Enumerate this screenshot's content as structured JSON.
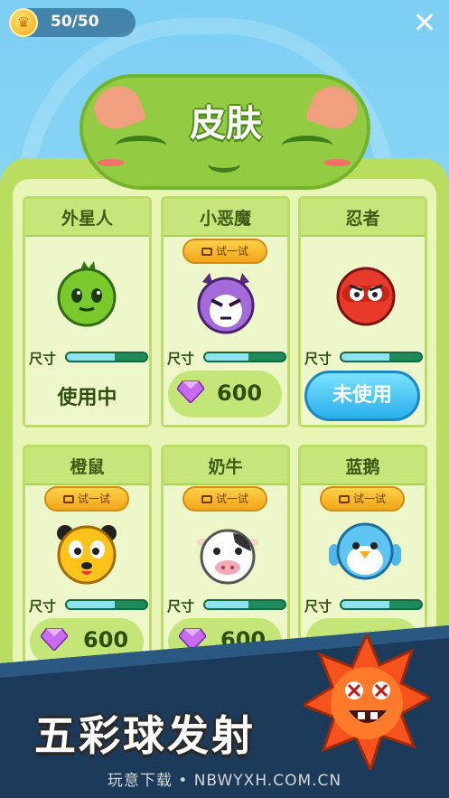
{
  "header": {
    "coin_count": "50/50",
    "close_icon": "close-icon"
  },
  "title": "皮肤",
  "skins": [
    {
      "name": "外星人",
      "size_label": "尺寸",
      "status": "使用中",
      "has_trial": false
    },
    {
      "name": "小恶魔",
      "size_label": "尺寸",
      "trial_label": "试一试",
      "price": "600",
      "has_trial": true
    },
    {
      "name": "忍者",
      "size_label": "尺寸",
      "button_label": "未使用",
      "has_trial": false
    },
    {
      "name": "橙鼠",
      "size_label": "尺寸",
      "trial_label": "试一试",
      "price": "600",
      "has_trial": true
    },
    {
      "name": "奶牛",
      "size_label": "尺寸",
      "trial_label": "试一试",
      "price": "600",
      "has_trial": true
    },
    {
      "name": "蓝鹅",
      "size_label": "尺寸",
      "trial_label": "试一试",
      "has_trial": true
    }
  ],
  "banner": {
    "title": "五彩球发射",
    "watermark": "玩意下载 • NBWYXH.COM.CN"
  },
  "colors": {
    "accent_green": "#93cc42",
    "button_blue": "#28b0ea",
    "trial_orange": "#f3a51a"
  }
}
